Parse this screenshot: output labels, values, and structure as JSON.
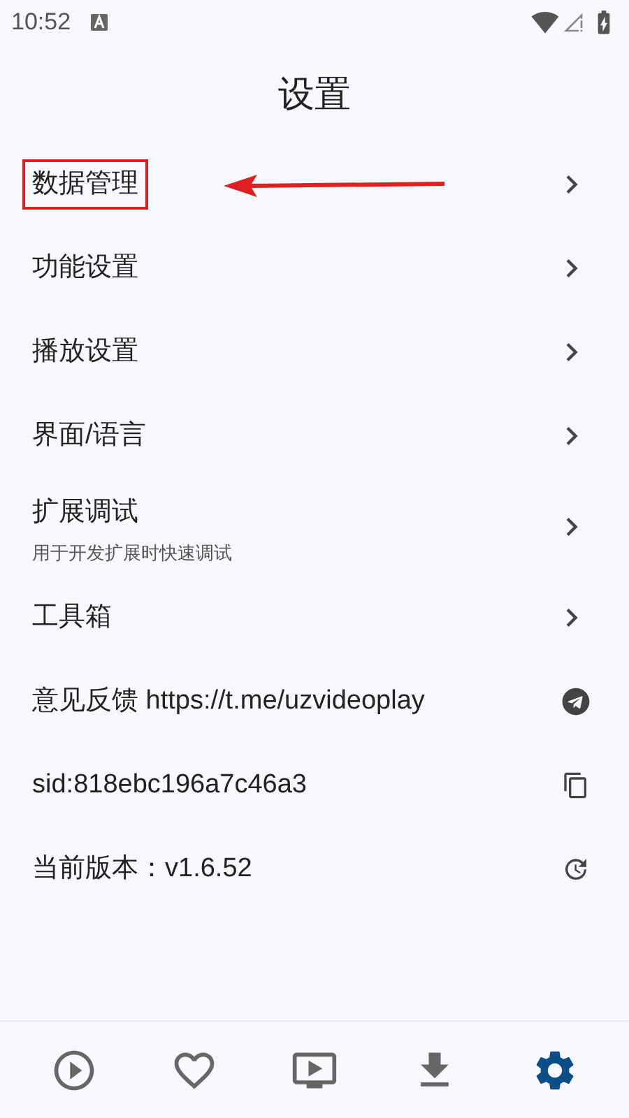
{
  "status_bar": {
    "time": "10:52"
  },
  "title": "设置",
  "items": [
    {
      "kind": "nav",
      "label": "数据管理",
      "highlighted": true
    },
    {
      "kind": "nav",
      "label": "功能设置",
      "highlighted": false
    },
    {
      "kind": "nav",
      "label": "播放设置",
      "highlighted": false
    },
    {
      "kind": "nav",
      "label": "界面/语言",
      "highlighted": false
    },
    {
      "kind": "nav",
      "label": "扩展调试",
      "subtitle": "用于开发扩展时快速调试",
      "highlighted": false
    },
    {
      "kind": "nav",
      "label": "工具箱",
      "highlighted": false
    },
    {
      "kind": "link",
      "label": "意见反馈 https://t.me/uzvideoplay",
      "highlighted": false
    },
    {
      "kind": "copy",
      "label": "sid:818ebc196a7c46a3",
      "highlighted": false
    },
    {
      "kind": "update",
      "label": "当前版本：v1.6.52",
      "highlighted": false
    }
  ],
  "bottom_nav": [
    {
      "kind": "play",
      "selected": false
    },
    {
      "kind": "favorites",
      "selected": false
    },
    {
      "kind": "tv",
      "selected": false
    },
    {
      "kind": "download",
      "selected": false
    },
    {
      "kind": "settings",
      "selected": true
    }
  ]
}
